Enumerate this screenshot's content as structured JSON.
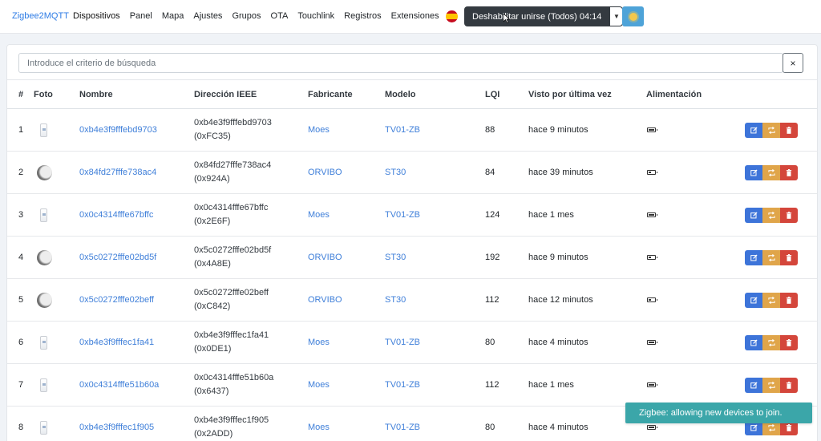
{
  "navbar": {
    "brand": "Zigbee2MQTT",
    "links": [
      "Dispositivos",
      "Panel",
      "Mapa",
      "Ajustes",
      "Grupos",
      "OTA",
      "Touchlink",
      "Registros",
      "Extensiones"
    ],
    "language_icon": "spain-flag-icon",
    "permit_join_label": "Deshabilitar unirse (Todos) 04:14",
    "theme_icon": "sun-icon"
  },
  "search": {
    "placeholder": "Introduce el criterio de búsqueda",
    "clear_label": "×"
  },
  "table": {
    "headers": [
      "#",
      "Foto",
      "Nombre",
      "Dirección IEEE",
      "Fabricante",
      "Modelo",
      "LQI",
      "Visto por última vez",
      "Alimentación",
      ""
    ],
    "rows": [
      {
        "num": "1",
        "photo": "valve",
        "name": "0xb4e3f9fffebd9703",
        "ieee": "0xb4e3f9fffebd9703",
        "nwk": "(0xFC35)",
        "manufacturer": "Moes",
        "model": "TV01-ZB",
        "lqi": "88",
        "last_seen": "hace 9 minutos",
        "power": "full"
      },
      {
        "num": "2",
        "photo": "sensor",
        "name": "0x84fd27fffe738ac4",
        "ieee": "0x84fd27fffe738ac4",
        "nwk": "(0x924A)",
        "manufacturer": "ORVIBO",
        "model": "ST30",
        "lqi": "84",
        "last_seen": "hace 39 minutos",
        "power": "low"
      },
      {
        "num": "3",
        "photo": "valve",
        "name": "0x0c4314fffe67bffc",
        "ieee": "0x0c4314fffe67bffc",
        "nwk": "(0x2E6F)",
        "manufacturer": "Moes",
        "model": "TV01-ZB",
        "lqi": "124",
        "last_seen": "hace 1 mes",
        "power": "full"
      },
      {
        "num": "4",
        "photo": "sensor",
        "name": "0x5c0272fffe02bd5f",
        "ieee": "0x5c0272fffe02bd5f",
        "nwk": "(0x4A8E)",
        "manufacturer": "ORVIBO",
        "model": "ST30",
        "lqi": "192",
        "last_seen": "hace 9 minutos",
        "power": "low"
      },
      {
        "num": "5",
        "photo": "sensor",
        "name": "0x5c0272fffe02beff",
        "ieee": "0x5c0272fffe02beff",
        "nwk": "(0xC842)",
        "manufacturer": "ORVIBO",
        "model": "ST30",
        "lqi": "112",
        "last_seen": "hace 12 minutos",
        "power": "low"
      },
      {
        "num": "6",
        "photo": "valve",
        "name": "0xb4e3f9fffec1fa41",
        "ieee": "0xb4e3f9fffec1fa41",
        "nwk": "(0x0DE1)",
        "manufacturer": "Moes",
        "model": "TV01-ZB",
        "lqi": "80",
        "last_seen": "hace 4 minutos",
        "power": "full"
      },
      {
        "num": "7",
        "photo": "valve",
        "name": "0x0c4314fffe51b60a",
        "ieee": "0x0c4314fffe51b60a",
        "nwk": "(0x6437)",
        "manufacturer": "Moes",
        "model": "TV01-ZB",
        "lqi": "112",
        "last_seen": "hace 1 mes",
        "power": "full"
      },
      {
        "num": "8",
        "photo": "valve",
        "name": "0xb4e3f9fffec1f905",
        "ieee": "0xb4e3f9fffec1f905",
        "nwk": "(0x2ADD)",
        "manufacturer": "Moes",
        "model": "TV01-ZB",
        "lqi": "80",
        "last_seen": "hace 4 minutos",
        "power": "full"
      }
    ],
    "action_icons": [
      "edit-icon",
      "rename-icon",
      "trash-icon"
    ]
  },
  "toast": {
    "message": "Zigbee: allowing new devices to join."
  },
  "colors": {
    "brand": "#2c7be5",
    "link": "#3f7fd9",
    "edit": "#3d74d9",
    "rename": "#e0a54a",
    "remove": "#d4463b",
    "toast": "#3ba6a9"
  }
}
